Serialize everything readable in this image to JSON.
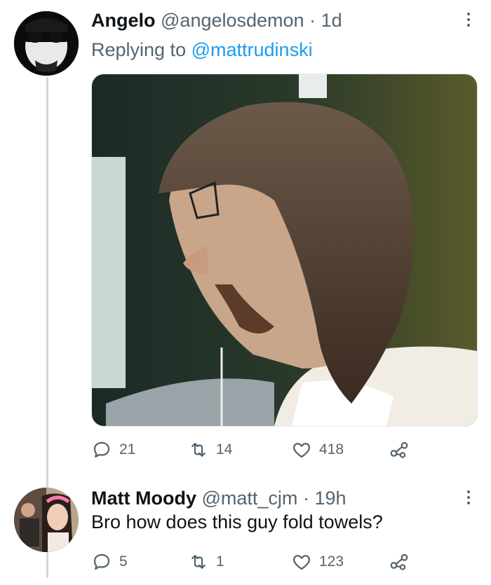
{
  "tweet": {
    "name": "Angelo",
    "handle": "@angelosdemon",
    "separator": "·",
    "time": "1d",
    "replying_prefix": "Replying to",
    "replying_to": "@mattrudinski",
    "media_description": "photo",
    "stats": {
      "replies": "21",
      "retweets": "14",
      "likes": "418"
    }
  },
  "reply": {
    "name": "Matt Moody",
    "handle": "@matt_cjm",
    "separator": "·",
    "time": "19h",
    "text": "Bro how does this guy fold towels?",
    "stats": {
      "replies": "5",
      "retweets": "1",
      "likes": "123"
    }
  },
  "colors": {
    "accent": "#1d9bf0",
    "muted": "#536471",
    "text": "#0f1419",
    "thread_line": "#cfd9de"
  },
  "icons": [
    "reply-icon",
    "retweet-icon",
    "like-icon",
    "share-icon",
    "more-icon"
  ]
}
